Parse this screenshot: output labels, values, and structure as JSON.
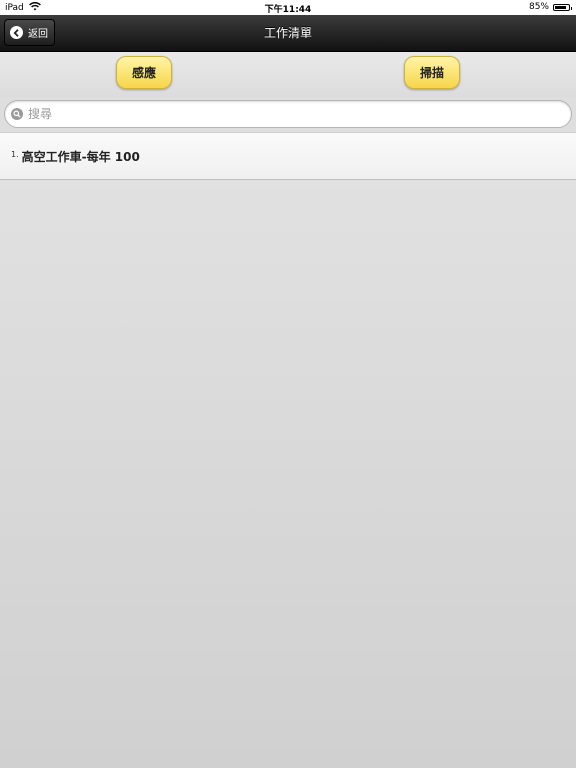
{
  "status_bar": {
    "device": "iPad",
    "time": "下午11:44",
    "battery": "85%",
    "battery_level": 0.85
  },
  "nav": {
    "back_label": "返回",
    "title": "工作清單"
  },
  "toolbar": {
    "sense_label": "感應",
    "scan_label": "掃描"
  },
  "search": {
    "placeholder": "搜尋",
    "value": ""
  },
  "list": {
    "items": [
      {
        "number": "1.",
        "label": "高空工作車-每年  100"
      }
    ]
  },
  "colors": {
    "button_yellow": "#f7d64a",
    "navbar": "#1e1e1e"
  }
}
